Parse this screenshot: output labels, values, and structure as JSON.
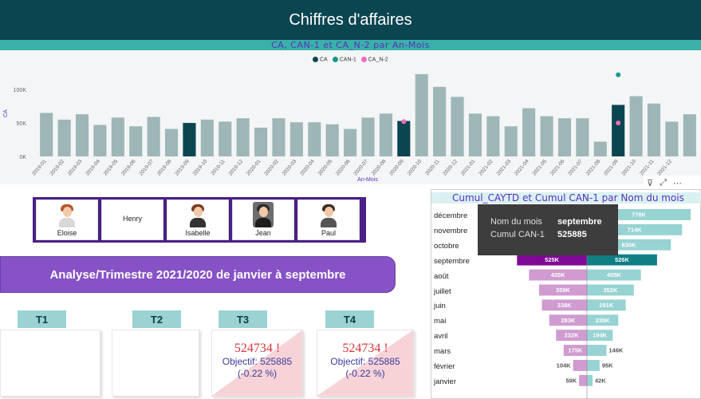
{
  "header": {
    "title": "Chiffres d'affaires"
  },
  "top_chart": {
    "title": "CA, CAN-1 et CA_N-2 par An-Mois",
    "legend": [
      {
        "label": "CA",
        "color": "#0b4550"
      },
      {
        "label": "CAN-1",
        "color": "#13988f"
      },
      {
        "label": "CA_N-2",
        "color": "#ee6dbe"
      }
    ],
    "ylabel": "CA",
    "xlabel": "An-Mois",
    "y_ticks": [
      "0K",
      "50K",
      "100K"
    ]
  },
  "chart_data": [
    {
      "type": "bar",
      "title": "CA, CAN-1 et CA_N-2 par An-Mois",
      "xlabel": "An-Mois",
      "ylabel": "CA",
      "ylim": [
        0,
        130000
      ],
      "legend": "top-center",
      "categories": [
        "2019-01",
        "2019-02",
        "2019-03",
        "2019-04",
        "2019-05",
        "2019-06",
        "2019-07",
        "2019-08",
        "2019-09",
        "2019-10",
        "2019-11",
        "2019-12",
        "2020-01",
        "2020-02",
        "2020-03",
        "2020-04",
        "2020-05",
        "2020-06",
        "2020-07",
        "2020-08",
        "2020-09",
        "2020-10",
        "2020-11",
        "2020-12",
        "2021-01",
        "2021-02",
        "2021-03",
        "2021-04",
        "2021-05",
        "2021-06",
        "2021-07",
        "2021-08",
        "2021-09",
        "2021-10",
        "2021-11",
        "2021-12"
      ],
      "series": [
        {
          "name": "CA",
          "values": [
            65000,
            55000,
            63000,
            47000,
            58000,
            45000,
            59000,
            41000,
            50000,
            55000,
            52000,
            57000,
            43000,
            57000,
            51000,
            51000,
            48000,
            41000,
            58000,
            64000,
            53000,
            123000,
            104000,
            89000,
            64000,
            60000,
            45000,
            72000,
            60000,
            57000,
            57000,
            22000,
            77000,
            90000,
            79000,
            52000,
            63000
          ]
        },
        {
          "name": "CAN-1",
          "values": [
            null,
            null,
            null,
            null,
            null,
            null,
            null,
            null,
            null,
            null,
            null,
            null,
            null,
            null,
            null,
            null,
            null,
            null,
            null,
            null,
            null,
            null,
            null,
            null,
            null,
            null,
            null,
            null,
            null,
            null,
            null,
            null,
            122000
          ]
        },
        {
          "name": "CA_N-2",
          "values": [
            null,
            null,
            null,
            null,
            null,
            null,
            null,
            null,
            null,
            null,
            null,
            null,
            null,
            null,
            null,
            null,
            null,
            null,
            null,
            null,
            52000,
            null,
            null,
            null,
            null,
            null,
            null,
            null,
            null,
            null,
            null,
            null,
            50000
          ]
        }
      ],
      "highlighted": [
        "2019-09",
        "2020-09",
        "2021-09"
      ]
    },
    {
      "type": "bar",
      "title": "Cumul_CAYTD et Cumul CAN-1 par Nom du mois",
      "categories": [
        "décembre",
        "novembre",
        "octobre",
        "septembre",
        "août",
        "juillet",
        "juin",
        "mai",
        "avril",
        "mars",
        "février",
        "janvier"
      ],
      "series": [
        {
          "name": "Cumul_CAYTD",
          "values": [
            null,
            null,
            null,
            525000,
            435000,
            359000,
            338000,
            283000,
            232000,
            175000,
            104000,
            59000
          ]
        },
        {
          "name": "Cumul CAN-1",
          "values": [
            778000,
            714000,
            630000,
            526000,
            405000,
            352000,
            291000,
            235000,
            194000,
            146000,
            95000,
            42000
          ]
        }
      ]
    }
  ],
  "people": [
    {
      "name": "Eloise"
    },
    {
      "name": "Henry"
    },
    {
      "name": "Isabelle"
    },
    {
      "name": "Jean"
    },
    {
      "name": "Paul"
    }
  ],
  "analysis": {
    "banner": "Analyse/Trimestre 2021/2020 de janvier à septembre"
  },
  "quarters": [
    {
      "label": "T1",
      "value": "",
      "objective": "",
      "pct": ""
    },
    {
      "label": "T2",
      "value": "",
      "objective": "",
      "pct": ""
    },
    {
      "label": "T3",
      "value": "524734 !",
      "objective": "Objectif: 525885",
      "pct": "(-0.22 %)"
    },
    {
      "label": "T4",
      "value": "524734 !",
      "objective": "Objectif: 525885",
      "pct": "(-0.22 %)"
    }
  ],
  "right_chart": {
    "title": "Cumul_CAYTD et Cumul CAN-1 par Nom du mois",
    "months": [
      "décembre",
      "novembre",
      "octobre",
      "septembre",
      "août",
      "juillet",
      "juin",
      "mai",
      "avril",
      "mars",
      "février",
      "janvier"
    ],
    "left_labels": [
      "",
      "",
      "",
      "525K",
      "435K",
      "359K",
      "338K",
      "283K",
      "232K",
      "175K",
      "104K",
      "59K"
    ],
    "right_labels": [
      "778K",
      "714K",
      "630K",
      "526K",
      "405K",
      "352K",
      "291K",
      "235K",
      "194K",
      "146K",
      "95K",
      "42K"
    ]
  },
  "tooltip": {
    "k1": "Nom du mois",
    "v1": "septembre",
    "k2": "Cumul CAN-1",
    "v2": "525885"
  },
  "toolbar": {
    "filter_icon": "filter-icon",
    "focus_icon": "focus-mode-icon",
    "more_icon": "more-options-icon"
  }
}
